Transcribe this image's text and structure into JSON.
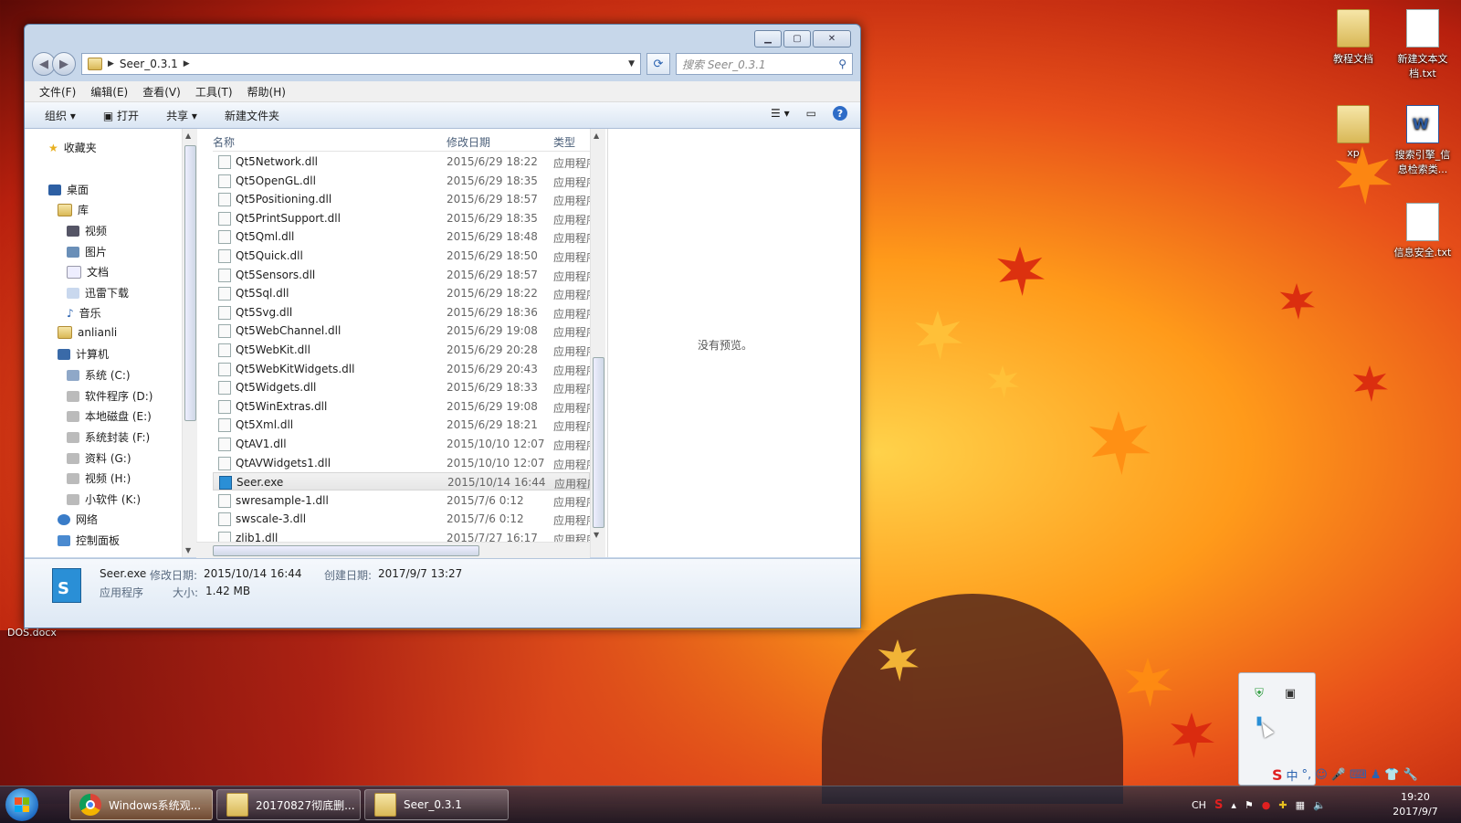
{
  "window": {
    "breadcrumb": "Seer_0.3.1",
    "search_placeholder": "搜索 Seer_0.3.1",
    "menu": [
      "文件(F)",
      "编辑(E)",
      "查看(V)",
      "工具(T)",
      "帮助(H)"
    ],
    "toolbar": {
      "organize": "组织",
      "open": "打开",
      "share": "共享",
      "new_folder": "新建文件夹"
    },
    "nav": {
      "favorites": "收藏夹",
      "desktop": "桌面",
      "libraries": "库",
      "videos": "视频",
      "pictures": "图片",
      "documents": "文档",
      "thunder": "迅雷下载",
      "music": "音乐",
      "user": "anlianli",
      "computer": "计算机",
      "drives": [
        "系统 (C:)",
        "软件程序 (D:)",
        "本地磁盘 (E:)",
        "系统封装 (F:)",
        "资料 (G:)",
        "视频 (H:)",
        "小软件 (K:)"
      ],
      "network": "网络",
      "control_panel": "控制面板"
    },
    "columns": {
      "name": "名称",
      "date": "修改日期",
      "type": "类型"
    },
    "files": [
      {
        "name": "Qt5Network.dll",
        "date": "2015/6/29 18:22",
        "type": "应用程序"
      },
      {
        "name": "Qt5OpenGL.dll",
        "date": "2015/6/29 18:35",
        "type": "应用程序"
      },
      {
        "name": "Qt5Positioning.dll",
        "date": "2015/6/29 18:57",
        "type": "应用程序"
      },
      {
        "name": "Qt5PrintSupport.dll",
        "date": "2015/6/29 18:35",
        "type": "应用程序"
      },
      {
        "name": "Qt5Qml.dll",
        "date": "2015/6/29 18:48",
        "type": "应用程序"
      },
      {
        "name": "Qt5Quick.dll",
        "date": "2015/6/29 18:50",
        "type": "应用程序"
      },
      {
        "name": "Qt5Sensors.dll",
        "date": "2015/6/29 18:57",
        "type": "应用程序"
      },
      {
        "name": "Qt5Sql.dll",
        "date": "2015/6/29 18:22",
        "type": "应用程序"
      },
      {
        "name": "Qt5Svg.dll",
        "date": "2015/6/29 18:36",
        "type": "应用程序"
      },
      {
        "name": "Qt5WebChannel.dll",
        "date": "2015/6/29 19:08",
        "type": "应用程序"
      },
      {
        "name": "Qt5WebKit.dll",
        "date": "2015/6/29 20:28",
        "type": "应用程序"
      },
      {
        "name": "Qt5WebKitWidgets.dll",
        "date": "2015/6/29 20:43",
        "type": "应用程序"
      },
      {
        "name": "Qt5Widgets.dll",
        "date": "2015/6/29 18:33",
        "type": "应用程序"
      },
      {
        "name": "Qt5WinExtras.dll",
        "date": "2015/6/29 19:08",
        "type": "应用程序"
      },
      {
        "name": "Qt5Xml.dll",
        "date": "2015/6/29 18:21",
        "type": "应用程序"
      },
      {
        "name": "QtAV1.dll",
        "date": "2015/10/10 12:07",
        "type": "应用程序"
      },
      {
        "name": "QtAVWidgets1.dll",
        "date": "2015/10/10 12:07",
        "type": "应用程序"
      },
      {
        "name": "Seer.exe",
        "date": "2015/10/14 16:44",
        "type": "应用程序",
        "selected": true
      },
      {
        "name": "swresample-1.dll",
        "date": "2015/7/6 0:12",
        "type": "应用程序"
      },
      {
        "name": "swscale-3.dll",
        "date": "2015/7/6 0:12",
        "type": "应用程序"
      },
      {
        "name": "zlib1.dll",
        "date": "2015/7/27 16:17",
        "type": "应用程序"
      }
    ],
    "preview_text": "没有预览。",
    "details": {
      "filename": "Seer.exe",
      "modified_label": "修改日期:",
      "modified": "2015/10/14 16:44",
      "created_label": "创建日期:",
      "created": "2017/9/7 13:27",
      "kind": "应用程序",
      "size_label": "大小:",
      "size": "1.42 MB"
    }
  },
  "desktop_icons": [
    {
      "label": "教程文档",
      "icon": "folder-icon"
    },
    {
      "label": "新建文本文档.txt",
      "icon": "text-file-icon"
    },
    {
      "label": "xp",
      "icon": "folder-icon"
    },
    {
      "label": "搜索引擎_信息检索类...",
      "icon": "word-file-icon"
    },
    {
      "label": "信息安全.txt",
      "icon": "text-file-icon"
    }
  ],
  "desktop_left": {
    "dos_file": "DOS.docx"
  },
  "taskbar": {
    "items": [
      "Windows系统观...",
      "20170827彻底删...",
      "Seer_0.3.1"
    ],
    "lang": "CH",
    "time": "19:20",
    "date": "2017/9/7"
  },
  "ime": {
    "mode": "中"
  },
  "colors": {
    "accent": "#2a62b0",
    "selection": "#e6e6e6",
    "exe_icon": "#2a8fd6"
  }
}
